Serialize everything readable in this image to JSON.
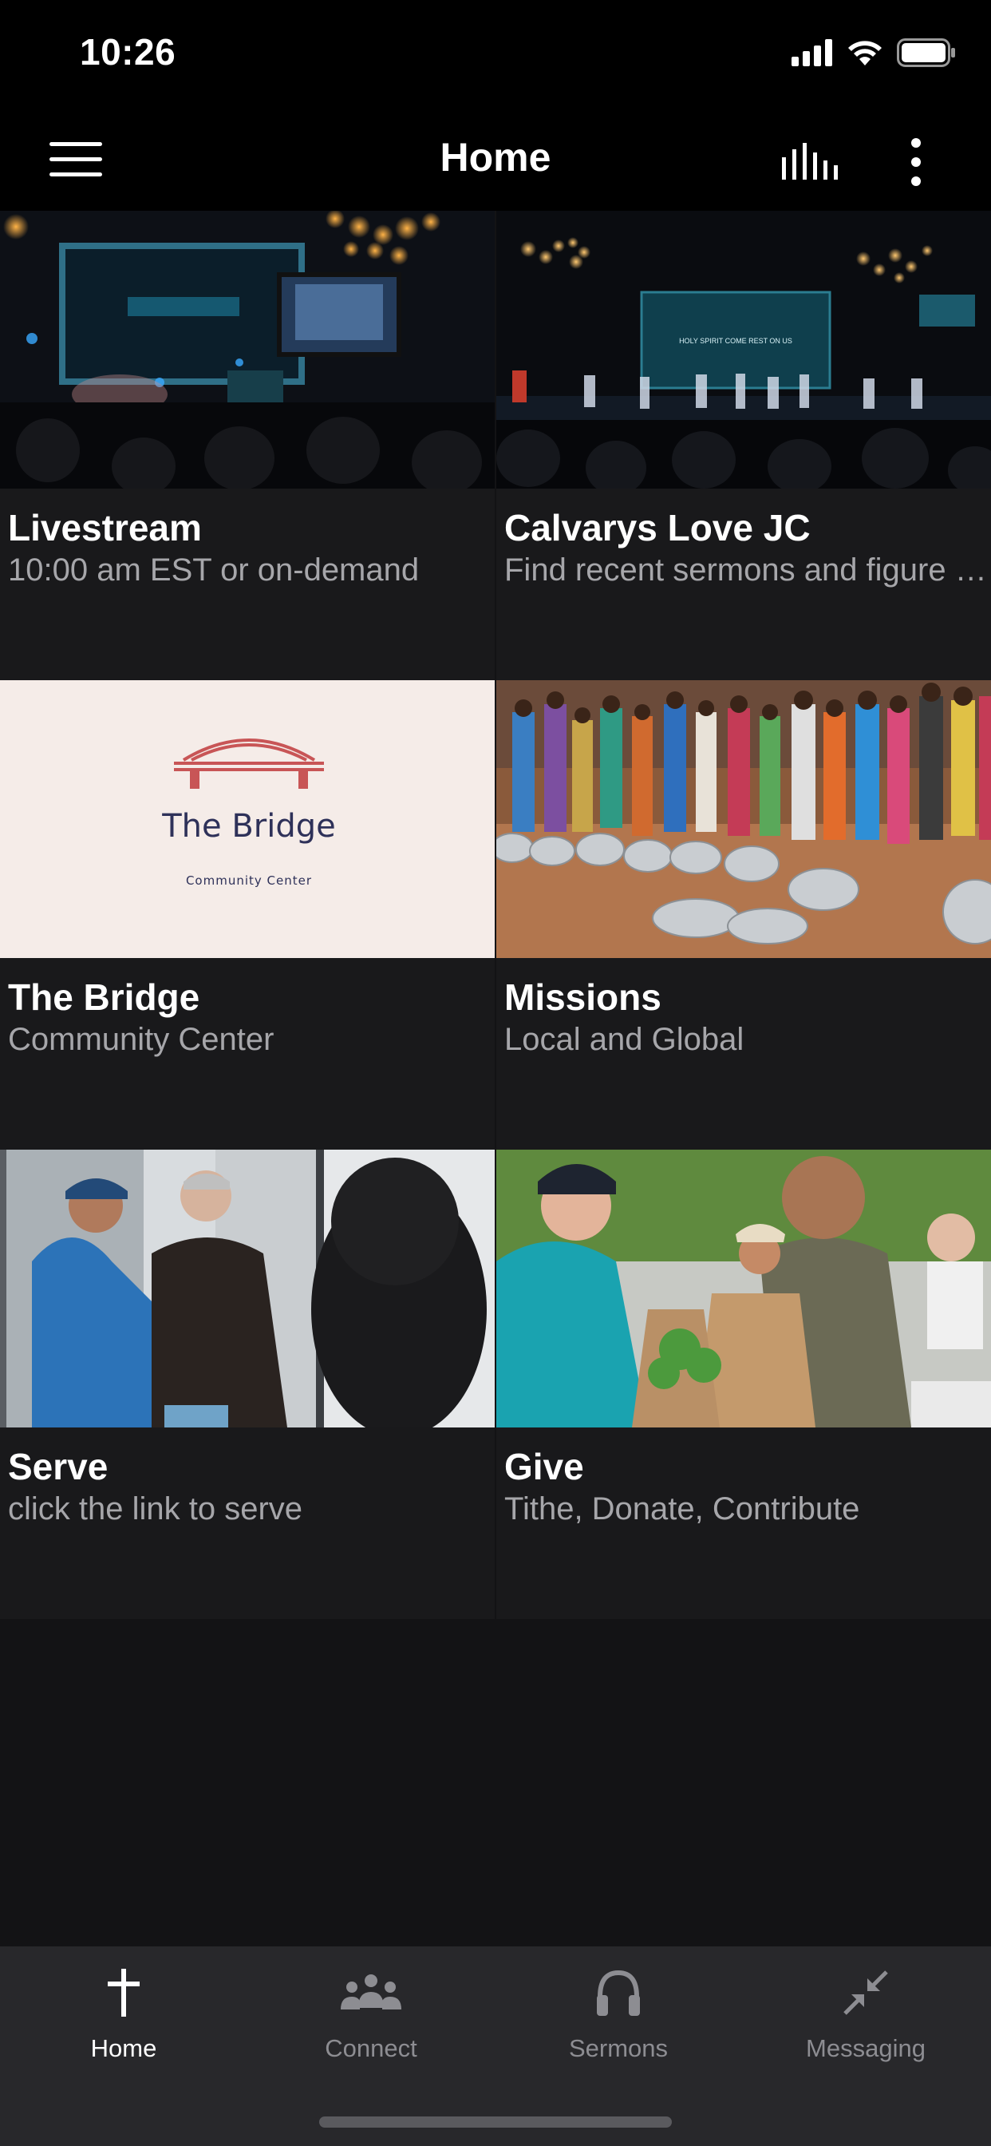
{
  "status_bar": {
    "time": "10:26"
  },
  "app_bar": {
    "title": "Home",
    "left_icon": "hamburger-menu-icon",
    "right_icons": [
      "audio-bars-icon",
      "more-vertical-icon"
    ]
  },
  "tiles": [
    {
      "title": "Livestream",
      "subtitle": "10:00 am EST or on-demand",
      "image": "worship-stage-photo"
    },
    {
      "title": "Calvarys Love JC",
      "subtitle": "Find recent sermons and figure out what's next",
      "image": "worship-band-photo",
      "screen_text": "HOLY SPIRIT COME REST ON US"
    },
    {
      "title": "The Bridge",
      "subtitle": "Community Center",
      "image": "the-bridge-logo",
      "logo_text": "The Bridge",
      "logo_subtext": "Community Center"
    },
    {
      "title": "Missions",
      "subtitle": "Local and Global",
      "image": "missions-women-bowls-photo"
    },
    {
      "title": "Serve",
      "subtitle": "click the link to serve",
      "image": "serve-handshake-photo"
    },
    {
      "title": "Give",
      "subtitle": "Tithe, Donate, Contribute",
      "image": "give-food-bags-photo"
    }
  ],
  "tab_bar": {
    "items": [
      {
        "label": "Home",
        "icon": "cross-icon",
        "active": true
      },
      {
        "label": "Connect",
        "icon": "group-icon",
        "active": false
      },
      {
        "label": "Sermons",
        "icon": "headphones-icon",
        "active": false
      },
      {
        "label": "Messaging",
        "icon": "minimize-arrows-icon",
        "active": false
      }
    ]
  },
  "colors": {
    "background": "#131315",
    "tile_background": "#19191b",
    "subtitle": "#a6a6aa",
    "tab_bar": "#28282b",
    "inactive_tab": "#8d8d92",
    "bridge_logo_red": "#c85556",
    "bridge_logo_navy": "#2e3159"
  }
}
